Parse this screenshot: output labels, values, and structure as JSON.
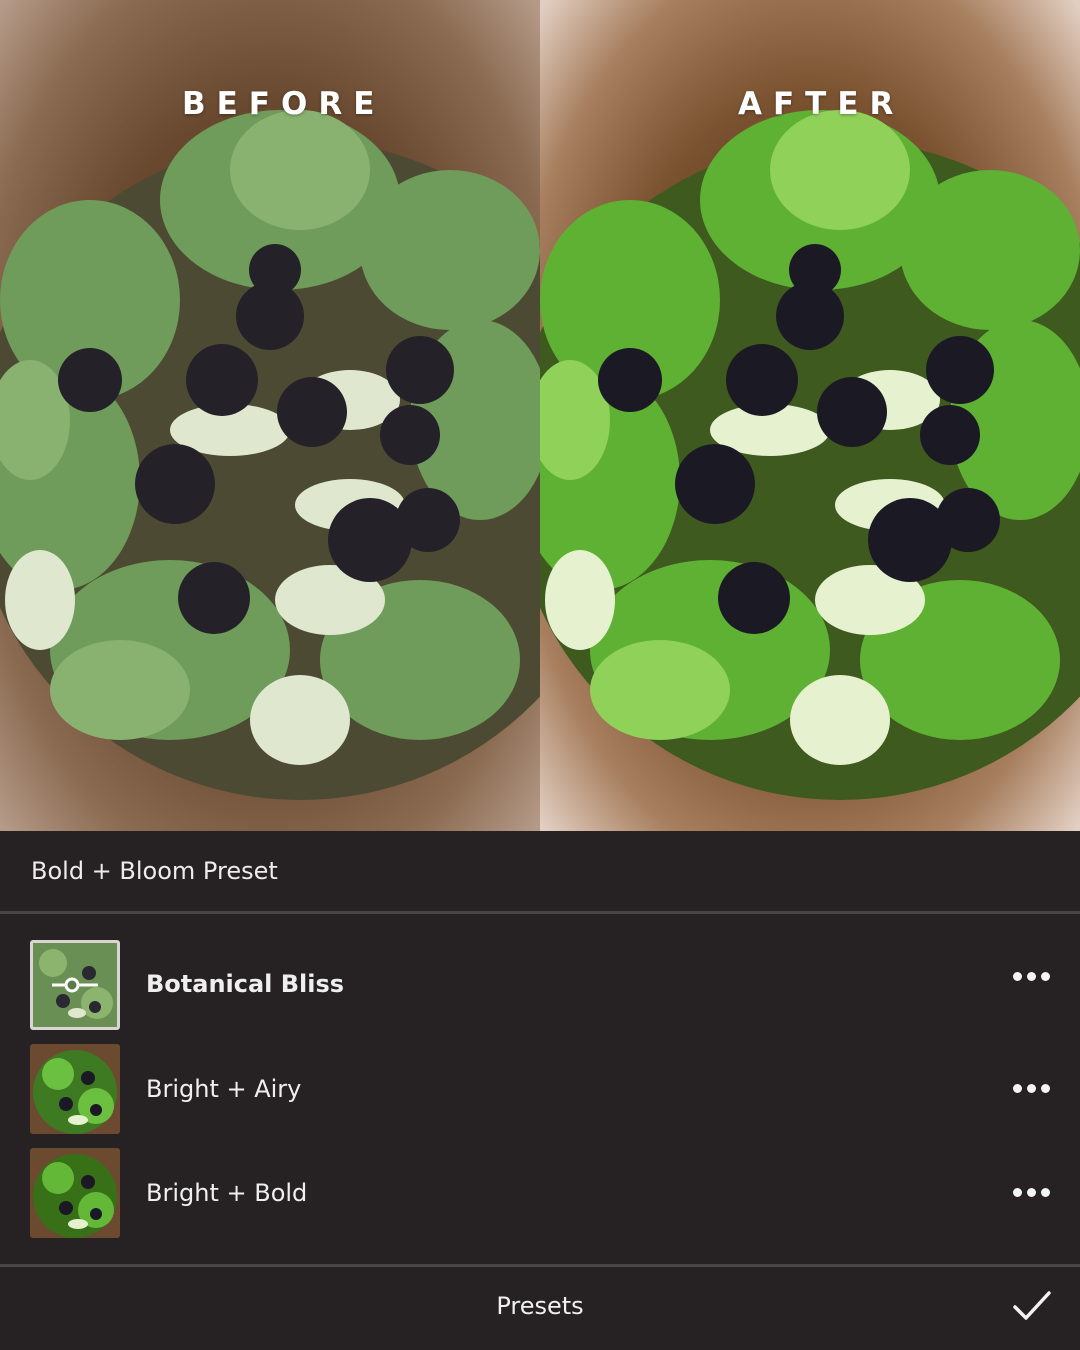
{
  "comparison": {
    "before_label": "BEFORE",
    "after_label": "AFTER"
  },
  "preset_pack": {
    "name": "Bold + Bloom Preset"
  },
  "presets": [
    {
      "label": "Botanical Bliss",
      "selected": true,
      "icon": "adjust-slider-icon"
    },
    {
      "label": "Bright + Airy",
      "selected": false
    },
    {
      "label": "Bright + Bold",
      "selected": false
    }
  ],
  "more_icon": "more-dots-icon",
  "bottom_bar": {
    "title": "Presets",
    "confirm_icon": "checkmark-icon"
  },
  "colors": {
    "background": "#262223",
    "divider": "#4a4647",
    "text": "#f0f0f0"
  }
}
